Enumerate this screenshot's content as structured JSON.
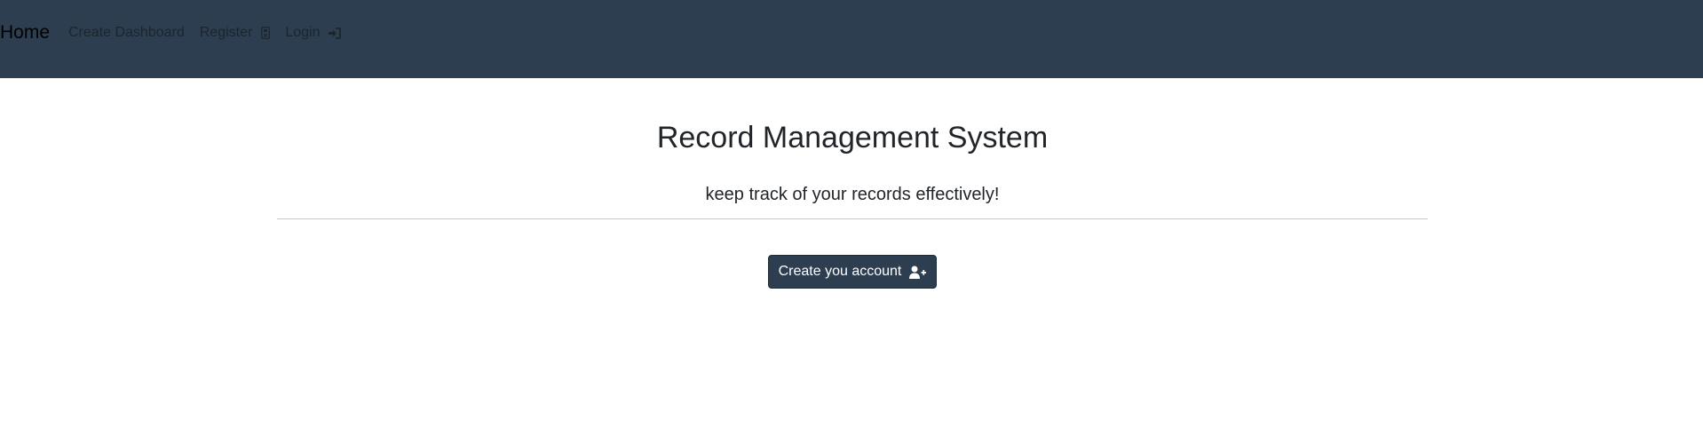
{
  "navbar": {
    "brand": "Home",
    "links": [
      {
        "label": "Create Dashboard",
        "icon": null
      },
      {
        "label": "Register",
        "icon": "register-card-icon"
      },
      {
        "label": "Login",
        "icon": "sign-in-icon"
      }
    ]
  },
  "main": {
    "title": "Record Management System",
    "subtitle": "keep track of your records effectively!",
    "cta_label": "Create you account",
    "cta_icon": "user-plus-icon"
  },
  "colors": {
    "navbar_bg": "#2c3e50",
    "button_bg": "#2c3e50",
    "text_dark": "#212529",
    "button_text": "#ffffff"
  }
}
